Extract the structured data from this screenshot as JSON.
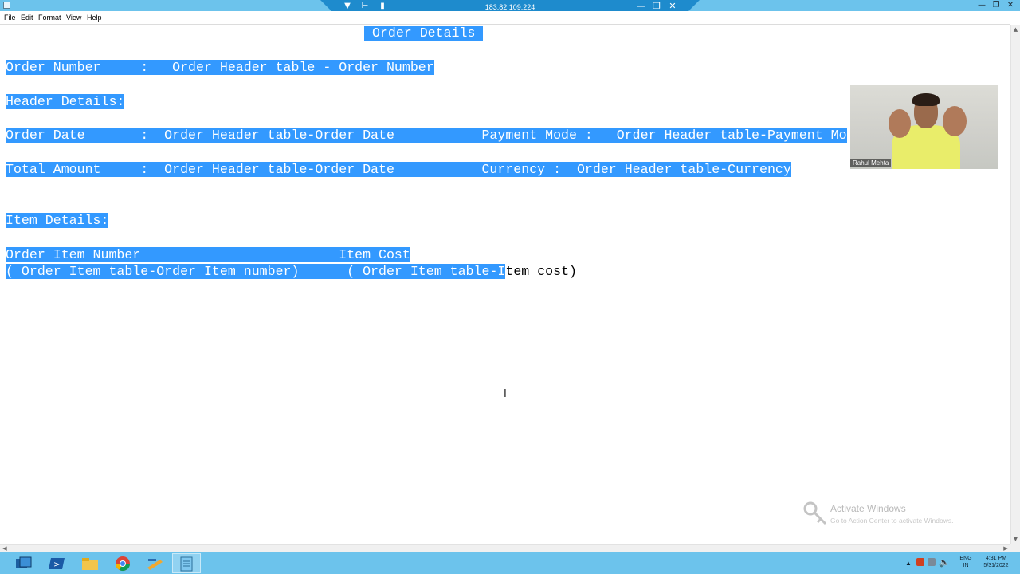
{
  "window": {
    "menu": [
      "File",
      "Edit",
      "Format",
      "View",
      "Help"
    ]
  },
  "rdp": {
    "ip": "183.82.109.224"
  },
  "document": {
    "lines": [
      "Order Details",
      "Order Number     :   Order Header table - Order Number",
      "Header Details:",
      "Order Date       :  Order Header table-Order Date           Payment Mode :   Order Header table-Payment Mo",
      "Total Amount     :  Order Header table-Order Date           Currency :  Order Header table-Currency",
      "Item Details:",
      "Order Item Number                         Item Cost",
      "( Order Item table-Order Item number)      ( Order Item table-I",
      "tem cost)"
    ]
  },
  "webcam": {
    "name": "Rahul Mehta"
  },
  "watermark": {
    "title": "Activate Windows",
    "subtitle": "Go to Action Center to activate Windows."
  },
  "taskbar": {
    "icons": [
      "server-manager-icon",
      "powershell-icon",
      "file-explorer-icon",
      "chrome-icon",
      "tool-icon",
      "notepad-icon"
    ],
    "lang": "ENG",
    "region": "IN",
    "time": "4:31 PM",
    "date": "5/31/2022"
  },
  "colors": {
    "selection": "#3399ff",
    "taskbar": "#6cc3ec",
    "rdp_bar": "#1e8bcd"
  }
}
